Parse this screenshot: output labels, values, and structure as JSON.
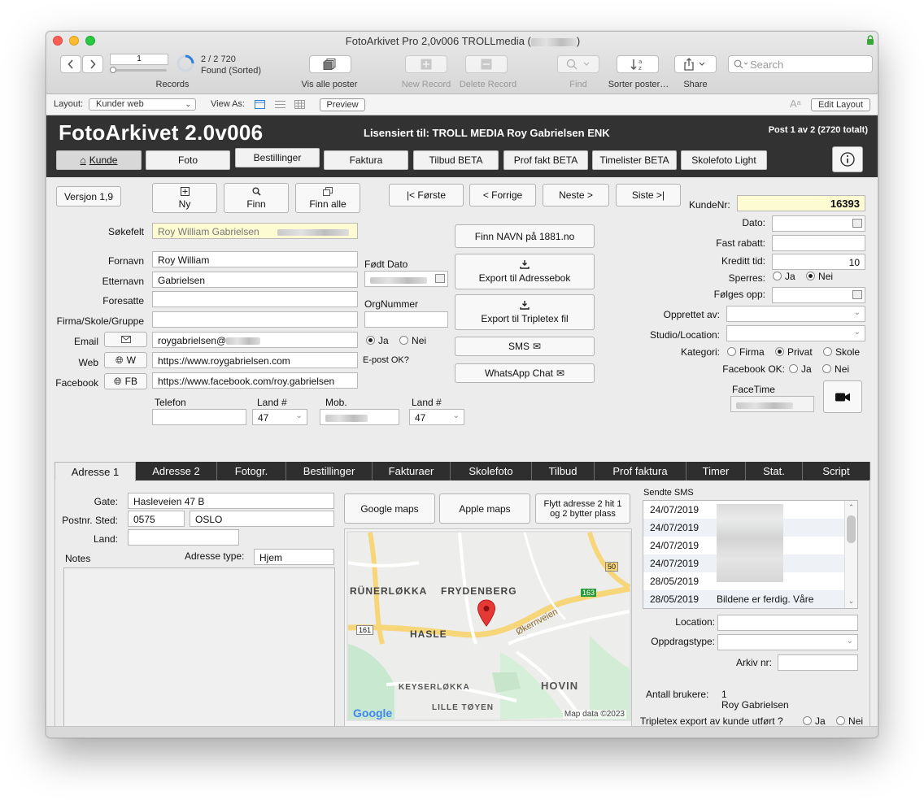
{
  "window": {
    "title_prefix": "FotoArkivet Pro 2,0v006 TROLLmedia (",
    "title_suffix": ")",
    "colors": {
      "close": "#fd5f57",
      "minimize": "#febc2e",
      "zoom": "#28c840"
    }
  },
  "toolbar": {
    "record_number": "1",
    "record_count": "2 / 2 720",
    "found_status": "Found (Sorted)",
    "records_label": "Records",
    "show_all_label": "Vis alle poster",
    "new_record_label": "New Record",
    "delete_record_label": "Delete Record",
    "find_label": "Find",
    "sort_label": "Sorter poster…",
    "share_label": "Share",
    "search_placeholder": "Search"
  },
  "layout_bar": {
    "layout_label": "Layout:",
    "layout_value": "Kunder web",
    "view_as_label": "View As:",
    "preview_label": "Preview",
    "edit_layout_label": "Edit Layout"
  },
  "header": {
    "app_title": "FotoArkivet 2.0v006",
    "license": "Lisensiert til: TROLL MEDIA Roy Gabrielsen ENK",
    "post_info": "Post 1 av 2 (2720 totalt)",
    "nav_tabs": [
      "Kunde",
      "Foto",
      "Bestillinger",
      "Faktura",
      "Tilbud BETA",
      "Prof fakt BETA",
      "Timelister BETA",
      "Skolefoto Light"
    ]
  },
  "actions": {
    "version": "Versjon 1,9",
    "new": "Ny",
    "find": "Finn",
    "find_all": "Finn alle",
    "first": "|< Første",
    "prev": "< Forrige",
    "next": "Neste >",
    "last": "Siste >|",
    "find_name_1881": "Finn NAVN på 1881.no",
    "export_address_book": "Export til Adressebok",
    "export_tripletex": "Export til Tripletex fil",
    "sms": "SMS",
    "whatsapp": "WhatsApp Chat"
  },
  "customer": {
    "search_label": "Søkefelt",
    "search_value": "Roy William Gabrielsen",
    "first_name_label": "Fornavn",
    "first_name": "Roy William",
    "last_name_label": "Etternavn",
    "last_name": "Gabrielsen",
    "custodian_label": "Foresatte",
    "custodian": "",
    "company_label": "Firma/Skole/Gruppe",
    "company": "",
    "email_label": "Email",
    "email": "roygabrielsen@",
    "web_label": "Web",
    "web_button": "W",
    "web": "https://www.roygabrielsen.com",
    "facebook_label": "Facebook",
    "facebook_button": "FB",
    "facebook": "https://www.facebook.com/roy.gabrielsen",
    "birth_label": "Født Dato",
    "org_label": "OrgNummer",
    "email_ok_label": "E-post OK?",
    "yes": "Ja",
    "no": "Nei",
    "phone_label": "Telefon",
    "country_label": "Land #",
    "country_code": "47",
    "mobile_label": "Mob.",
    "mobile_country_code": "47"
  },
  "right_panel": {
    "customer_no_label": "KundeNr:",
    "customer_no": "16393",
    "date_label": "Dato:",
    "discount_label": "Fast rabatt:",
    "credit_label": "Kreditt tid:",
    "credit_value": "10",
    "blocked_label": "Sperres:",
    "follow_up_label": "Følges opp:",
    "created_by_label": "Opprettet av:",
    "studio_label": "Studio/Location:",
    "category_label": "Kategori:",
    "category_options": [
      "Firma",
      "Privat",
      "Skole"
    ],
    "facebook_ok_label": "Facebook OK:",
    "facetime_label": "FaceTime"
  },
  "tabs": [
    "Adresse 1",
    "Adresse 2",
    "Fotogr.",
    "Bestillinger",
    "Fakturaer",
    "Skolefoto",
    "Tilbud",
    "Prof faktura",
    "Timer",
    "Stat.",
    "Script"
  ],
  "address": {
    "street_label": "Gate:",
    "street": "Hasleveien 47 B",
    "postal_label": "Postnr. Sted:",
    "postal_code": "0575",
    "city": "OSLO",
    "country_label": "Land:",
    "country": "",
    "notes_label": "Notes",
    "address_type_label": "Adresse type:",
    "address_type": "Hjem",
    "google_maps": "Google maps",
    "apple_maps": "Apple maps",
    "move_address": "Flytt adresse 2 hit 1 og 2 bytter plass"
  },
  "map": {
    "labels": [
      "RÜNERLØKKA",
      "FRYDENBERG",
      "HASLE",
      "Økernveien",
      "KEYSERLØKKA",
      "LILLE TØYEN",
      "HOVIN"
    ],
    "road_numbers": [
      "161",
      "163",
      "50"
    ],
    "attribution": "Map data ©2023",
    "logo": "Google"
  },
  "sms": {
    "header": "Sendte SMS",
    "rows": [
      {
        "date": "24/07/2019",
        "text": ""
      },
      {
        "date": "24/07/2019",
        "text": ""
      },
      {
        "date": "24/07/2019",
        "text": ""
      },
      {
        "date": "24/07/2019",
        "text": ""
      },
      {
        "date": "28/05/2019",
        "text": ""
      },
      {
        "date": "28/05/2019",
        "text": "Bildene er ferdig. Våre"
      }
    ]
  },
  "bottom_right": {
    "location_label": "Location:",
    "assignment_label": "Oppdragstype:",
    "archive_label": "Arkiv nr:",
    "users_label": "Antall brukere:",
    "users_count": "1",
    "users_name": "Roy Gabrielsen",
    "tripletex_label": "Tripletex export av kunde utført ?"
  }
}
